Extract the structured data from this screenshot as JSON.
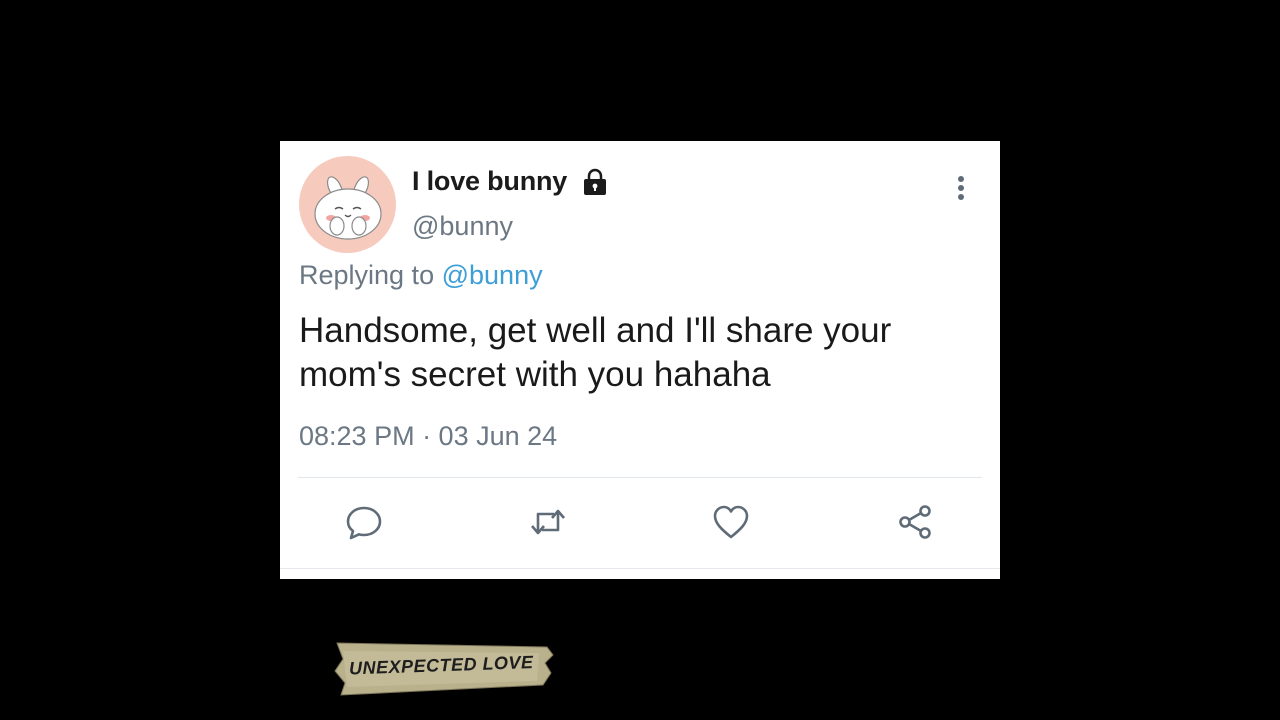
{
  "tweet": {
    "display_name": "I love bunny",
    "handle": "@bunny",
    "replying_prefix": "Replying to",
    "replying_handle": "@bunny",
    "text": "Handsome, get well and I'll share your mom's secret with you hahaha",
    "timestamp": "08:23 PM · 03 Jun 24"
  },
  "icons": {
    "lock": "lock-icon",
    "more": "more-vertical-icon",
    "reply": "comment-bubble-icon",
    "retweet": "retweet-icon",
    "like": "heart-icon",
    "share": "share-icon"
  },
  "overlay": {
    "label": "UNEXPECTED LOVE"
  },
  "colors": {
    "background": "#000000",
    "card": "#ffffff",
    "mention": "#3d9fd6",
    "muted": "#6b7884",
    "avatar_bg": "#f6cbbd"
  }
}
